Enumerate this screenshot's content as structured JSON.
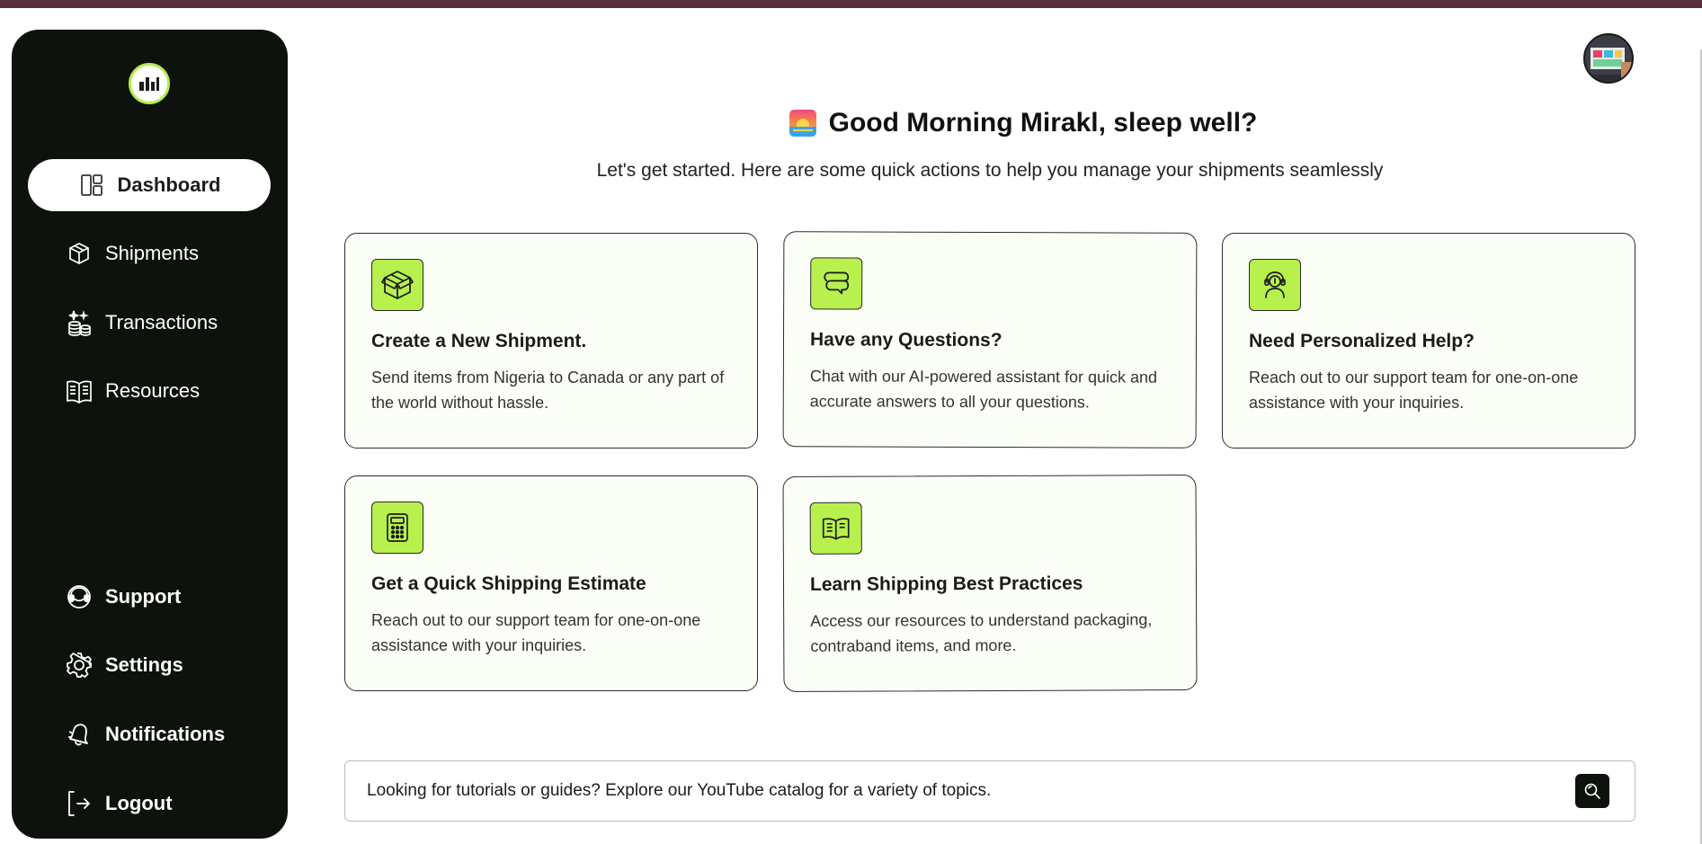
{
  "app": {
    "greeting": "Good Morning Mirakl, sleep well?",
    "subtitle": "Let's get started. Here are some quick actions to help you manage your shipments seamlessly"
  },
  "sidebar": {
    "logo_icon": "brand-logo-icon",
    "nav": [
      {
        "label": "Dashboard",
        "icon": "dashboard-icon",
        "active": true
      },
      {
        "label": "Shipments",
        "icon": "package-icon"
      },
      {
        "label": "Transactions",
        "icon": "coins-icon"
      },
      {
        "label": "Resources",
        "icon": "book-icon"
      }
    ],
    "bottom": [
      {
        "label": "Support",
        "icon": "headset-icon"
      },
      {
        "label": "Settings",
        "icon": "gear-icon"
      },
      {
        "label": "Notifications",
        "icon": "bell-icon"
      },
      {
        "label": "Logout",
        "icon": "logout-icon"
      }
    ]
  },
  "cards": [
    {
      "title": "Create a New Shipment.",
      "desc": "Send items from Nigeria to Canada or any part of the world without hassle.",
      "icon": "box-icon"
    },
    {
      "title": "Have any Questions?",
      "desc": "Chat with our AI-powered assistant for quick and accurate answers to all your questions.",
      "icon": "chat-icon"
    },
    {
      "title": "Need Personalized Help?",
      "desc": "Reach out to our support team for one-on-one assistance with your inquiries.",
      "icon": "support-agent-icon"
    },
    {
      "title": "Get a Quick Shipping Estimate",
      "desc": "Reach out to our support team for one-on-one assistance with your inquiries.",
      "icon": "calculator-icon"
    },
    {
      "title": "Learn Shipping Best Practices",
      "desc": "Access our resources to understand packaging, contraband items, and more.",
      "icon": "open-book-icon"
    }
  ],
  "search": {
    "text": "Looking for tutorials or guides? Explore our YouTube catalog for a variety of topics.",
    "icon": "search-icon"
  },
  "colors": {
    "sidebar_bg": "#0e120c",
    "accent": "#b8f04e",
    "card_bg": "#fbfef6",
    "top_bar": "#5a2d3f"
  }
}
